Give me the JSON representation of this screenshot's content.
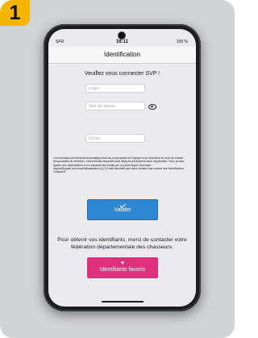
{
  "step": {
    "number": "1"
  },
  "status_bar": {
    "carrier": "SFR",
    "time": "16:11",
    "battery": "100 %"
  },
  "navbar": {
    "title": "Identification"
  },
  "form": {
    "prompt": "Veuillez vous connecter SVP !",
    "login_placeholder": "Login",
    "password_placeholder": "Mot de passe",
    "email_placeholder": "Email"
  },
  "info_text": "Les résultats sont transmis automatiquement au responsable de l'équipe et au détenteur du droit de chasse (responsable du territoire). Leurs Emails respectifs sont déjà pré-paramétrés dans l'application. Vous pouvez ajouter des destinataires ici en séparant les emails par un point-virgule (Exemple : dupont@gmail.com;martin@wanadoo.fr) (*) Email facultatif sauf dans certains cas comme une identification \"chasseur\"",
  "buttons": {
    "validate": "Valider",
    "favorites": "Identifiants favoris"
  },
  "contact_text": "Pour obtenir vos identifiants, merci de contacter votre fédération départementale des chasseurs.",
  "colors": {
    "badge": "#f5b400",
    "validate": "#2f86d2",
    "favorites": "#e0317d"
  },
  "icons": {
    "eye": "eye-icon",
    "check": "check-icon",
    "heart": "heart-icon"
  }
}
